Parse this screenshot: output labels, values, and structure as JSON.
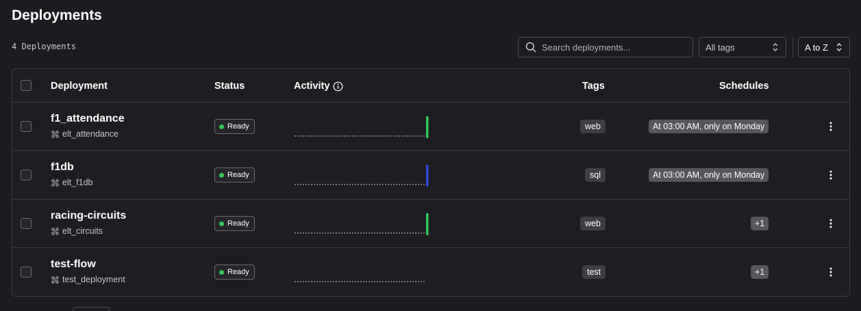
{
  "page": {
    "title": "Deployments",
    "count_label": "4 Deployments"
  },
  "toolbar": {
    "search_placeholder": "Search deployments...",
    "tags_filter": "All tags",
    "sort": "A to Z"
  },
  "table": {
    "columns": [
      "Deployment",
      "Status",
      "Activity",
      "Tags",
      "Schedules"
    ],
    "rows": [
      {
        "name": "f1_attendance",
        "flow": "elt_attendance",
        "status": "Ready",
        "activity_latest_color": "#34c759",
        "tag": "web",
        "schedule": "At 03:00 AM, only on Monday"
      },
      {
        "name": "f1db",
        "flow": "elt_f1db",
        "status": "Ready",
        "activity_latest_color": "#2f4bd8",
        "tag": "sql",
        "schedule": "At 03:00 AM, only on Monday"
      },
      {
        "name": "racing-circuits",
        "flow": "elt_circuits",
        "status": "Ready",
        "activity_latest_color": "#34c759",
        "tag": "web",
        "schedule": "+1"
      },
      {
        "name": "test-flow",
        "flow": "test_deployment",
        "status": "Ready",
        "activity_latest_color": null,
        "tag": "test",
        "schedule": "+1"
      }
    ]
  },
  "colors": {
    "background": "#1c1c20",
    "ready": "#34c759",
    "completed_run": "#34c759",
    "scheduled_run": "#2f4bd8"
  }
}
